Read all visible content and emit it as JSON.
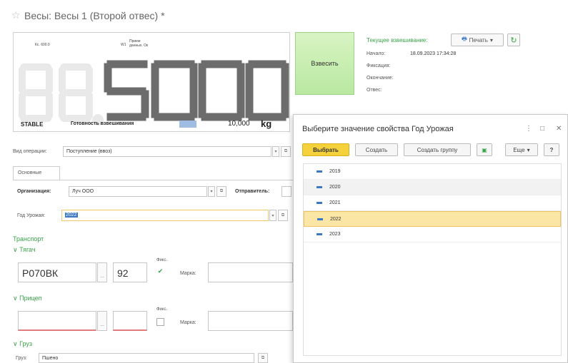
{
  "window": {
    "title": "Весы: Весы 1 (Второй отвес) *"
  },
  "scale": {
    "mini_left": "Кс. 600.0",
    "mini_mid_label": "W1",
    "mini_mid_text": "Прием данных. Ок",
    "display_value": "5000",
    "ghost_digits": "88.",
    "stable_label": "STABLE",
    "ready_label": "Готовность взвешивания",
    "capacity": "10,000",
    "unit": "kg"
  },
  "weigh_button": {
    "label": "Взвесить"
  },
  "current": {
    "title": "Текущее взвешивание:",
    "print_label": "Печать",
    "start_label": "Начало:",
    "start_value": "18.09.2023 17:34:28",
    "fix_label": "Фиксация:",
    "end_label": "Окончание:",
    "weight_label": "Отвес:"
  },
  "form": {
    "operation_label": "Вид операции:",
    "operation_value": "Поступление (ввоз)",
    "tab_main": "Основные",
    "org_label": "Организация:",
    "org_value": "Луч ООО",
    "sender_label": "Отправитель:",
    "year_label": "Год Урожая:",
    "year_value": "2022",
    "transport_title": "Транспорт",
    "tractor_title": "Тягач",
    "tractor_number": "Р070ВК",
    "tractor_region": "92",
    "fix_label": "Фикс.",
    "brand_label": "Марка:",
    "trailer_title": "Прицеп",
    "cargo_title": "Груз",
    "cargo_label": "Груз:",
    "cargo_value": "Пшено"
  },
  "popup": {
    "title": "Выберите значение свойства Год Урожая",
    "select_label": "Выбрать",
    "create_label": "Создать",
    "create_group_label": "Создать группу",
    "more_label": "Еще",
    "help_label": "?",
    "items": [
      "2019",
      "2020",
      "2021",
      "2022",
      "2023"
    ],
    "selected_index": 3
  },
  "colors": {
    "accent_green": "#3aa34a",
    "select_yellow": "#f5d23c",
    "row_selected": "#fbe6a6",
    "segment_gray": "#666666"
  }
}
